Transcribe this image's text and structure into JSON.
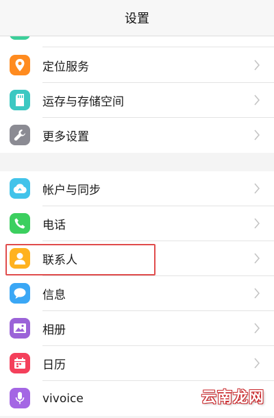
{
  "header": {
    "title": "设置"
  },
  "colors": {
    "location_icon": "#ff8b1f",
    "storage_icon": "#3cc8c2",
    "more_settings_icon": "#8b8b93",
    "accounts_icon": "#42c3ea",
    "phone_icon": "#3ccf5f",
    "contacts_icon": "#ffb21f",
    "messages_icon": "#3aa7f5",
    "album_icon": "#9b63d8",
    "calendar_icon": "#f4405b",
    "vivoice_icon": "#a466e4",
    "highlight_border": "#e04b4b"
  },
  "group1": {
    "items": [
      {
        "label": "定位服务",
        "icon": "location-pin-icon"
      },
      {
        "label": "运存与存储空间",
        "icon": "sd-card-icon"
      },
      {
        "label": "更多设置",
        "icon": "wrench-icon"
      }
    ]
  },
  "group2": {
    "items": [
      {
        "label": "帐户与同步",
        "icon": "cloud-sync-icon"
      },
      {
        "label": "电话",
        "icon": "phone-icon"
      },
      {
        "label": "联系人",
        "icon": "contact-person-icon",
        "highlighted": true
      },
      {
        "label": "信息",
        "icon": "message-bubble-icon"
      },
      {
        "label": "相册",
        "icon": "photo-album-icon"
      },
      {
        "label": "日历",
        "icon": "calendar-icon"
      },
      {
        "label": "vivoice",
        "icon": "microphone-icon"
      }
    ]
  },
  "watermark": {
    "text": "云南龙网"
  }
}
